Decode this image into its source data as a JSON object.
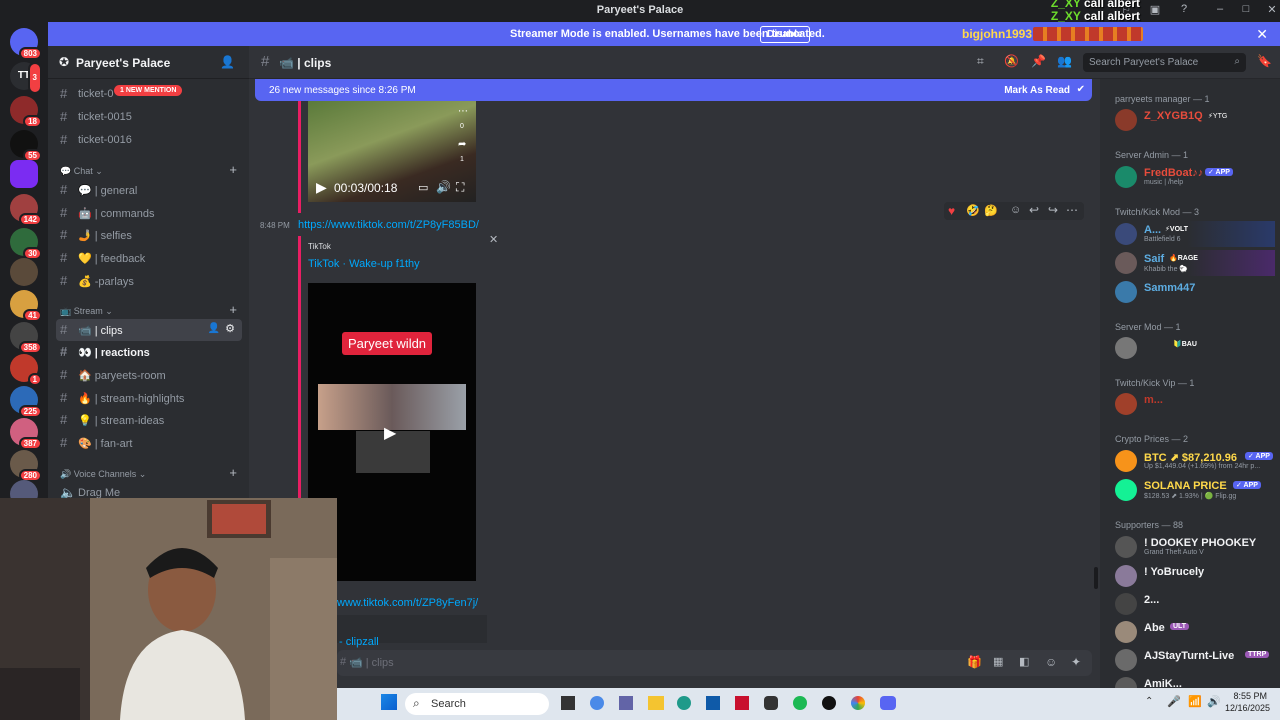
{
  "window": {
    "title": "Paryeet's Palace"
  },
  "overlay_chat": [
    {
      "user": "Z_XY",
      "text": "call albert"
    },
    {
      "user": "Z_XY",
      "text": "call albert"
    }
  ],
  "banner": {
    "message": "Streamer Mode is enabled. Usernames have been truncated.",
    "disable_label": "Disable",
    "donor": "bigjohn1993"
  },
  "rail": {
    "badges": [
      "803",
      "3",
      "18",
      "55",
      "142",
      "30",
      "41",
      "358",
      "1",
      "225",
      "387",
      "280"
    ],
    "tt_label": "TT"
  },
  "server": {
    "name": "Paryeet's Palace"
  },
  "sidebar": {
    "mention_pill": "1 NEW MENTION",
    "top_channels": [
      "ticket-0",
      "ticket-0015",
      "ticket-0016"
    ],
    "chat_category": "Chat",
    "chat_channels": [
      "💬 | general",
      "🤖 | commands",
      "🤳 | selfies",
      "💛 | feedback",
      "💰 -parlays"
    ],
    "stream_category": "Stream",
    "stream_channels": [
      "📹 | clips",
      "👀 | reactions",
      "🏠 paryeets-room",
      "🔥 | stream-highlights",
      "💡 | stream-ideas",
      "🎨 | fan-art"
    ],
    "voice_category": "Voice Channels",
    "voice_channels": [
      "Drag Me"
    ]
  },
  "chat": {
    "channel_name": "📹 | clips",
    "search_placeholder": "Search Paryeet's Palace",
    "new_messages": "26 new messages since 8:26 PM",
    "mark_as_read": "Mark As Read",
    "video1": {
      "time": "00:03/00:18",
      "side_counts": [
        "0",
        "1"
      ]
    },
    "msg_time": "8:48 PM",
    "link1": "https://www.tiktok.com/t/ZP8yF85BD/",
    "embed": {
      "provider": "TikTok",
      "title": "TikTok · Wake-up f1thy",
      "caption": "Paryeet wildn"
    },
    "link2": "www.tiktok.com/t/ZP8yFen7j/",
    "link3": "- clipzall",
    "composer_placeholder": "📹 | clips"
  },
  "members": {
    "groups": [
      {
        "label": "parryeets manager — 1"
      },
      {
        "label": "Server Admin — 1"
      },
      {
        "label": "Twitch/Kick Mod — 3"
      },
      {
        "label": "Server Mod — 1"
      },
      {
        "label": "Twitch/Kick Vip — 1"
      },
      {
        "label": "Crypto Prices — 2"
      },
      {
        "label": "Supporters — 88"
      }
    ],
    "list": [
      {
        "name": "Z_XYGB1Q",
        "tag": "⚡YTG",
        "sub": "",
        "color": "#e74c3c"
      },
      {
        "name": "FredBoat♪♪",
        "tag": "✓ APP",
        "sub": "music | /help",
        "color": "#e74c3c"
      },
      {
        "name": "A...",
        "tag": "⚡VOLT",
        "sub": "Battlefield 6",
        "color": "#5dade2"
      },
      {
        "name": "Saif",
        "tag": "🔥RAGE",
        "sub": "Khabib the 🐑",
        "color": "#5dade2"
      },
      {
        "name": "Samm447",
        "tag": "",
        "sub": "",
        "color": "#5dade2"
      },
      {
        "name": "     ",
        "tag": "🔰BAU",
        "sub": "",
        "color": "#2e4db8"
      },
      {
        "name": "m...",
        "tag": "",
        "sub": "",
        "color": "#c0392b"
      },
      {
        "name": "BTC ⬈ $87,210.96",
        "tag": "✓ APP",
        "sub": "Up $1,449.04 (+1.69%) from 24hr p...",
        "color": "#ffd94a"
      },
      {
        "name": "SOLANA PRICE",
        "tag": "✓ APP",
        "sub": "$128.53 ⬈ 1.93% | 🟢 Flip.gg",
        "color": "#ffd94a"
      },
      {
        "name": "! DOOKEY PHOOKEY",
        "tag": "",
        "sub": "Grand Theft Auto V",
        "color": "#f2f3f5"
      },
      {
        "name": "! YoBrucely",
        "tag": "",
        "sub": "",
        "color": "#f2f3f5"
      },
      {
        "name": "2...",
        "tag": "",
        "sub": "",
        "color": "#f2f3f5"
      },
      {
        "name": "Abe",
        "tag": "ULT",
        "sub": "",
        "color": "#f2f3f5"
      },
      {
        "name": "AJStayTurnt-Live",
        "tag": "TTRP",
        "sub": "",
        "color": "#f2f3f5"
      },
      {
        "name": "AmiK...",
        "tag": "",
        "sub": "",
        "color": "#f2f3f5"
      }
    ]
  },
  "taskbar": {
    "search": "Search",
    "time": "8:55 PM",
    "date": "12/16/2025"
  }
}
